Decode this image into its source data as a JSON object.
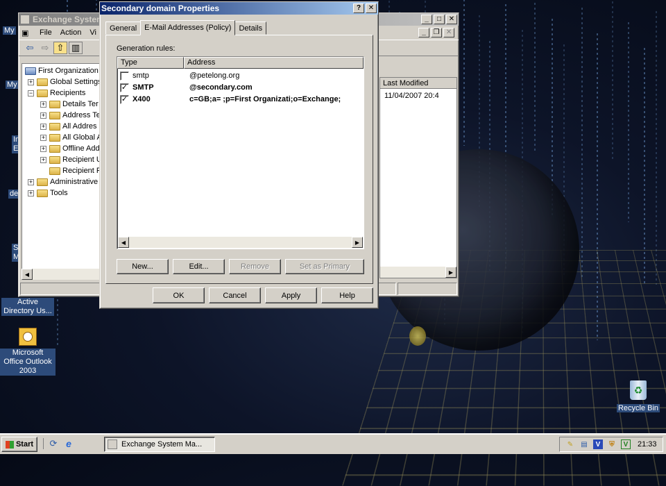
{
  "desktop": {
    "icons": [
      {
        "label": "My"
      },
      {
        "label": "My"
      },
      {
        "label": "Active Directory Us..."
      },
      {
        "label": "Microsoft Office Outlook 2003"
      },
      {
        "label": "Recycle Bin"
      }
    ],
    "partial_labels": [
      "de",
      "In",
      "E",
      "S",
      "M"
    ]
  },
  "exchange_window": {
    "title": "Exchange System",
    "menu": [
      "File",
      "Action",
      "Vi"
    ],
    "tree": [
      {
        "label": "First Organization",
        "level": 0
      },
      {
        "label": "Global Settings",
        "level": 1
      },
      {
        "label": "Recipients",
        "level": 1
      },
      {
        "label": "Details Ter",
        "level": 2
      },
      {
        "label": "Address Te",
        "level": 2
      },
      {
        "label": "All Addres",
        "level": 2
      },
      {
        "label": "All Global A",
        "level": 2
      },
      {
        "label": "Offline Add",
        "level": 2
      },
      {
        "label": "Recipient U",
        "level": 2
      },
      {
        "label": "Recipient F",
        "level": 2
      },
      {
        "label": "Administrative",
        "level": 1
      },
      {
        "label": "Tools",
        "level": 1
      }
    ],
    "list_header": "Last Modified",
    "list_value": "11/04/2007  20:4"
  },
  "dialog": {
    "title": "Secondary domain Properties",
    "title_buttons": [
      "?",
      "✕"
    ],
    "tabs": [
      "General",
      "E-Mail Addresses (Policy)",
      "Details"
    ],
    "selected_tab": 1,
    "generation_rules_label": "Generation rules:",
    "columns": [
      "Type",
      "Address"
    ],
    "rows": [
      {
        "checked": false,
        "type": "smtp",
        "address": "@petelong.org",
        "bold": false
      },
      {
        "checked": true,
        "type": "SMTP",
        "address": "@secondary.com",
        "bold": true
      },
      {
        "checked": true,
        "type": "X400",
        "address": "c=GB;a= ;p=First Organizati;o=Exchange;",
        "bold": true
      }
    ],
    "action_buttons": [
      {
        "label": "New...",
        "disabled": false
      },
      {
        "label": "Edit...",
        "disabled": false
      },
      {
        "label": "Remove",
        "disabled": true
      },
      {
        "label": "Set as Primary",
        "disabled": true
      }
    ],
    "bottom_buttons": [
      "OK",
      "Cancel",
      "Apply",
      "Help"
    ]
  },
  "taskbar": {
    "start_label": "Start",
    "task_label": "Exchange System Ma...",
    "clock": "21:33"
  }
}
